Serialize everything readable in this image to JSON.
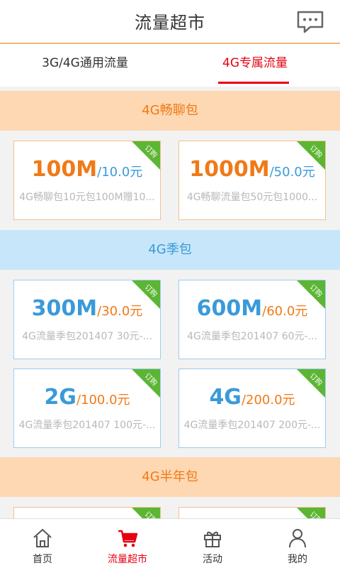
{
  "header": {
    "title": "流量超市",
    "message_icon": "chat-bubble-icon"
  },
  "tabs": [
    {
      "label": "3G/4G通用流量",
      "active": false
    },
    {
      "label": "4G专属流量",
      "active": true
    }
  ],
  "ribbon_label": "订购",
  "sections": [
    {
      "title": "4G畅聊包",
      "theme": "orange",
      "cards": [
        {
          "amount": "100M",
          "fee": "/10.0元",
          "desc": "4G畅聊包10元包100M赠10..."
        },
        {
          "amount": "1000M",
          "fee": "/50.0元",
          "desc": "4G畅聊流量包50元包1000..."
        }
      ]
    },
    {
      "title": "4G季包",
      "theme": "blue",
      "cards": [
        {
          "amount": "300M",
          "fee": "/30.0元",
          "desc": "4G流量季包201407 30元-..."
        },
        {
          "amount": "600M",
          "fee": "/60.0元",
          "desc": "4G流量季包201407 60元-..."
        },
        {
          "amount": "2G",
          "fee": "/100.0元",
          "desc": "4G流量季包201407 100元-..."
        },
        {
          "amount": "4G",
          "fee": "/200.0元",
          "desc": "4G流量季包201407 200元-..."
        }
      ]
    },
    {
      "title": "4G半年包",
      "theme": "orange",
      "cards": []
    }
  ],
  "bottom_nav": [
    {
      "label": "首页",
      "icon": "home-icon",
      "active": false
    },
    {
      "label": "流量超市",
      "icon": "shopping-cart-icon",
      "active": true
    },
    {
      "label": "活动",
      "icon": "gift-icon",
      "active": false
    },
    {
      "label": "我的",
      "icon": "person-icon",
      "active": false
    }
  ],
  "colors": {
    "accent_red": "#e60012",
    "orange": "#f07a16",
    "blue": "#3a9ad9",
    "ribbon_green": "#5cb533"
  }
}
